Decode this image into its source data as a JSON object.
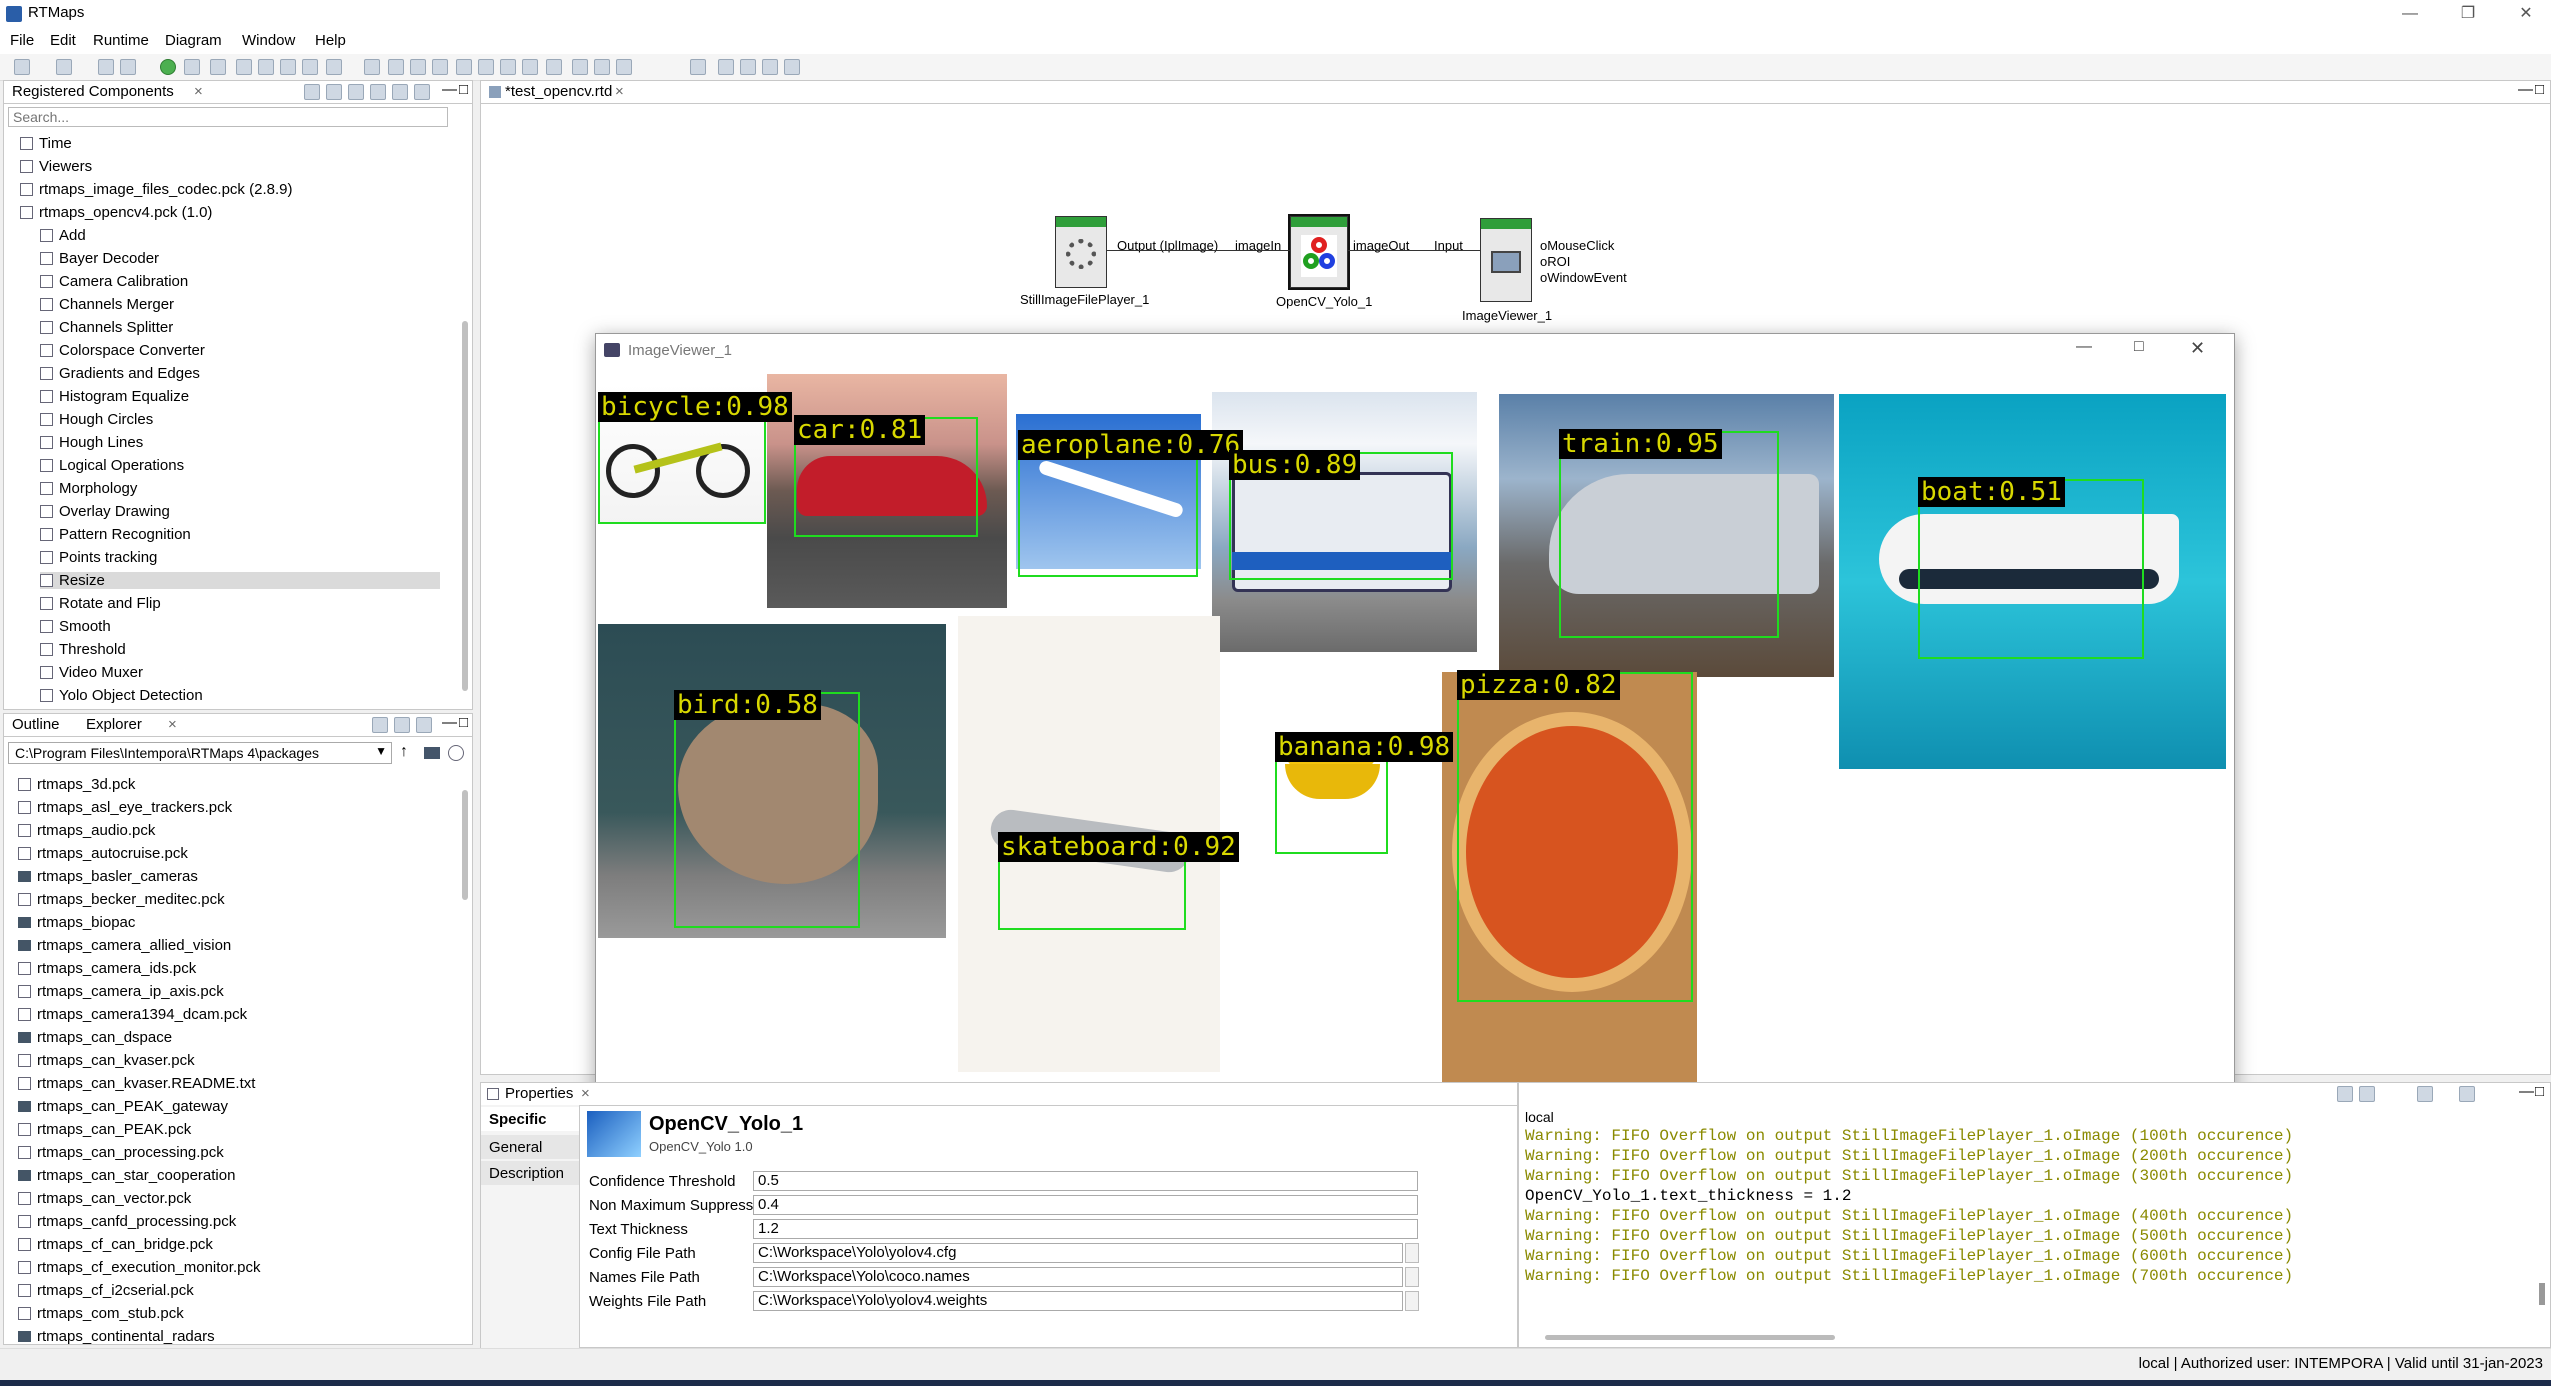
{
  "window": {
    "title": "RTMaps"
  },
  "menu": [
    "File",
    "Edit",
    "Runtime",
    "Diagram",
    "Window",
    "Help"
  ],
  "registered": {
    "tab": "Registered Components",
    "search_placeholder": "Search...",
    "items": [
      {
        "label": "Time",
        "level": 1
      },
      {
        "label": "Viewers",
        "level": 1
      },
      {
        "label": "rtmaps_image_files_codec.pck (2.8.9)",
        "level": 1
      },
      {
        "label": "rtmaps_opencv4.pck (1.0)",
        "level": 1
      },
      {
        "label": "Add",
        "level": 2
      },
      {
        "label": "Bayer Decoder",
        "level": 2
      },
      {
        "label": "Camera Calibration",
        "level": 2
      },
      {
        "label": "Channels Merger",
        "level": 2
      },
      {
        "label": "Channels Splitter",
        "level": 2
      },
      {
        "label": "Colorspace Converter",
        "level": 2
      },
      {
        "label": "Gradients and Edges",
        "level": 2
      },
      {
        "label": "Histogram Equalize",
        "level": 2
      },
      {
        "label": "Hough Circles",
        "level": 2
      },
      {
        "label": "Hough Lines",
        "level": 2
      },
      {
        "label": "Logical Operations",
        "level": 2
      },
      {
        "label": "Morphology",
        "level": 2
      },
      {
        "label": "Overlay Drawing",
        "level": 2
      },
      {
        "label": "Pattern Recognition",
        "level": 2
      },
      {
        "label": "Points tracking",
        "level": 2
      },
      {
        "label": "Resize",
        "level": 2
      },
      {
        "label": "Rotate and Flip",
        "level": 2
      },
      {
        "label": "Smooth",
        "level": 2
      },
      {
        "label": "Threshold",
        "level": 2
      },
      {
        "label": "Video Muxer",
        "level": 2
      },
      {
        "label": "Yolo Object Detection",
        "level": 2
      }
    ]
  },
  "explorer": {
    "tabs": [
      "Outline",
      "Explorer"
    ],
    "path": "C:\\Program Files\\Intempora\\RTMaps 4\\packages",
    "items": [
      {
        "label": "rtmaps_3d.pck",
        "kind": "file"
      },
      {
        "label": "rtmaps_asl_eye_trackers.pck",
        "kind": "file"
      },
      {
        "label": "rtmaps_audio.pck",
        "kind": "file"
      },
      {
        "label": "rtmaps_autocruise.pck",
        "kind": "file"
      },
      {
        "label": "rtmaps_basler_cameras",
        "kind": "folder"
      },
      {
        "label": "rtmaps_becker_meditec.pck",
        "kind": "file"
      },
      {
        "label": "rtmaps_biopac",
        "kind": "folder"
      },
      {
        "label": "rtmaps_camera_allied_vision",
        "kind": "folder"
      },
      {
        "label": "rtmaps_camera_ids.pck",
        "kind": "file"
      },
      {
        "label": "rtmaps_camera_ip_axis.pck",
        "kind": "file"
      },
      {
        "label": "rtmaps_camera1394_dcam.pck",
        "kind": "file"
      },
      {
        "label": "rtmaps_can_dspace",
        "kind": "folder"
      },
      {
        "label": "rtmaps_can_kvaser.pck",
        "kind": "file"
      },
      {
        "label": "rtmaps_can_kvaser.README.txt",
        "kind": "file"
      },
      {
        "label": "rtmaps_can_PEAK_gateway",
        "kind": "folder"
      },
      {
        "label": "rtmaps_can_PEAK.pck",
        "kind": "file"
      },
      {
        "label": "rtmaps_can_processing.pck",
        "kind": "file"
      },
      {
        "label": "rtmaps_can_star_cooperation",
        "kind": "folder"
      },
      {
        "label": "rtmaps_can_vector.pck",
        "kind": "file"
      },
      {
        "label": "rtmaps_canfd_processing.pck",
        "kind": "file"
      },
      {
        "label": "rtmaps_cf_can_bridge.pck",
        "kind": "file"
      },
      {
        "label": "rtmaps_cf_execution_monitor.pck",
        "kind": "file"
      },
      {
        "label": "rtmaps_cf_i2cserial.pck",
        "kind": "file"
      },
      {
        "label": "rtmaps_com_stub.pck",
        "kind": "file"
      },
      {
        "label": "rtmaps_continental_radars",
        "kind": "folder"
      }
    ]
  },
  "diagram": {
    "tab": "*test_opencv.rtd",
    "nodes": {
      "player": {
        "name": "StillImageFilePlayer_1",
        "out": "Output (IplImage)"
      },
      "yolo": {
        "name": "OpenCV_Yolo_1",
        "in": "imageIn",
        "out": "imageOut"
      },
      "viewer": {
        "name": "ImageViewer_1",
        "in": "Input",
        "outs": [
          "oMouseClick",
          "oROI",
          "oWindowEvent"
        ]
      }
    }
  },
  "viewer_window": {
    "title": "ImageViewer_1",
    "detections": [
      {
        "label": "bicycle:0.98"
      },
      {
        "label": "car:0.81"
      },
      {
        "label": "aeroplane:0.76"
      },
      {
        "label": "bus:0.89"
      },
      {
        "label": "train:0.95"
      },
      {
        "label": "boat:0.51"
      },
      {
        "label": "bird:0.58"
      },
      {
        "label": "skateboard:0.92"
      },
      {
        "label": "banana:0.98"
      },
      {
        "label": "pizza:0.82"
      }
    ]
  },
  "properties": {
    "tab": "Properties",
    "side_tabs": [
      "Specific",
      "General",
      "Description"
    ],
    "component_name": "OpenCV_Yolo_1",
    "component_sub": "OpenCV_Yolo 1.0",
    "rows": [
      {
        "label": "Confidence Threshold",
        "value": "0.5"
      },
      {
        "label": "Non Maximum Suppression Threshold",
        "value": "0.4"
      },
      {
        "label": "Text Thickness",
        "value": "1.2"
      },
      {
        "label": "Config File Path",
        "value": "C:\\Workspace\\Yolo\\yolov4.cfg"
      },
      {
        "label": "Names File Path",
        "value": "C:\\Workspace\\Yolo\\coco.names"
      },
      {
        "label": "Weights File Path",
        "value": "C:\\Workspace\\Yolo\\yolov4.weights"
      }
    ]
  },
  "console": {
    "title": "local",
    "warning_color": "#8a8a00",
    "lines": [
      {
        "text": "Warning: FIFO Overflow on output StillImageFilePlayer_1.oImage (100th occurence)",
        "warn": true
      },
      {
        "text": "Warning: FIFO Overflow on output StillImageFilePlayer_1.oImage (200th occurence)",
        "warn": true
      },
      {
        "text": "Warning: FIFO Overflow on output StillImageFilePlayer_1.oImage (300th occurence)",
        "warn": true
      },
      {
        "text": "OpenCV_Yolo_1.text_thickness = 1.2",
        "warn": false
      },
      {
        "text": "Warning: FIFO Overflow on output StillImageFilePlayer_1.oImage (400th occurence)",
        "warn": true
      },
      {
        "text": "Warning: FIFO Overflow on output StillImageFilePlayer_1.oImage (500th occurence)",
        "warn": true
      },
      {
        "text": "Warning: FIFO Overflow on output StillImageFilePlayer_1.oImage (600th occurence)",
        "warn": true
      },
      {
        "text": "Warning: FIFO Overflow on output StillImageFilePlayer_1.oImage (700th occurence)",
        "warn": true
      }
    ]
  },
  "status": {
    "text": "local | Authorized user: INTEMPORA | Valid until 31-jan-2023"
  },
  "colors": {
    "accent": "#1fdc1f",
    "node_green": "#2f9e3a"
  }
}
